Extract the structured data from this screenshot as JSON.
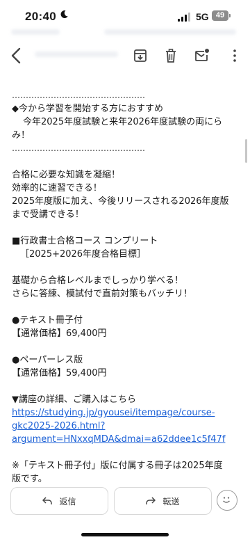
{
  "status_bar": {
    "time": "20:40",
    "network": "5G",
    "battery": "49",
    "moon_icon": "moon-icon",
    "signal_icon": "signal-icon"
  },
  "toolbar": {
    "icons": [
      "back-arrow-icon",
      "archive-icon",
      "trash-icon",
      "mark-unread-icon",
      "more-vert-icon"
    ]
  },
  "body": {
    "rule": "…………………………………………",
    "course_for": "◆今から学習を開始する方におすすめ",
    "course_for_2": "今年2025年度試験と来年2026年度試験の両にら",
    "course_for_3": "み！",
    "point_1": "合格に必要な知識を凝縮！",
    "point_2": "効率的に速習できる！",
    "point_3": "2025年度版に加え、今後リリースされる2026年度版",
    "point_4": "まで受講できる！",
    "course_name": "■行政書士合格コース コンプリート",
    "course_target": "［2025+2026年度合格目標］",
    "desc_1": "基礎から合格レベルまでしっかり学べる！",
    "desc_2": "さらに答練、模試付で直前対策もバッチリ！",
    "opt1_name": "●テキスト冊子付",
    "opt1_price": "【通常価格】69,400円",
    "opt2_name": "●ペーパーレス版",
    "opt2_price": "【通常価格】59,400円",
    "detail_header": "▼講座の詳細、ご購入はこちら",
    "link_1": "https://studying.jp/gyousei/itempage/course-",
    "link_2": "gkc2025-2026.html?",
    "link_3": "argument=HNxxqMDA&dmai=a62ddee1c5f47f",
    "note_1": "※「テキスト冊子付」版に付属する冊子は2025年度",
    "note_2": "版です。"
  },
  "actions": {
    "reply": "返信",
    "forward": "転送",
    "reply_icon": "reply-icon",
    "forward_icon": "forward-icon",
    "emoji_icon": "emoji-icon"
  }
}
